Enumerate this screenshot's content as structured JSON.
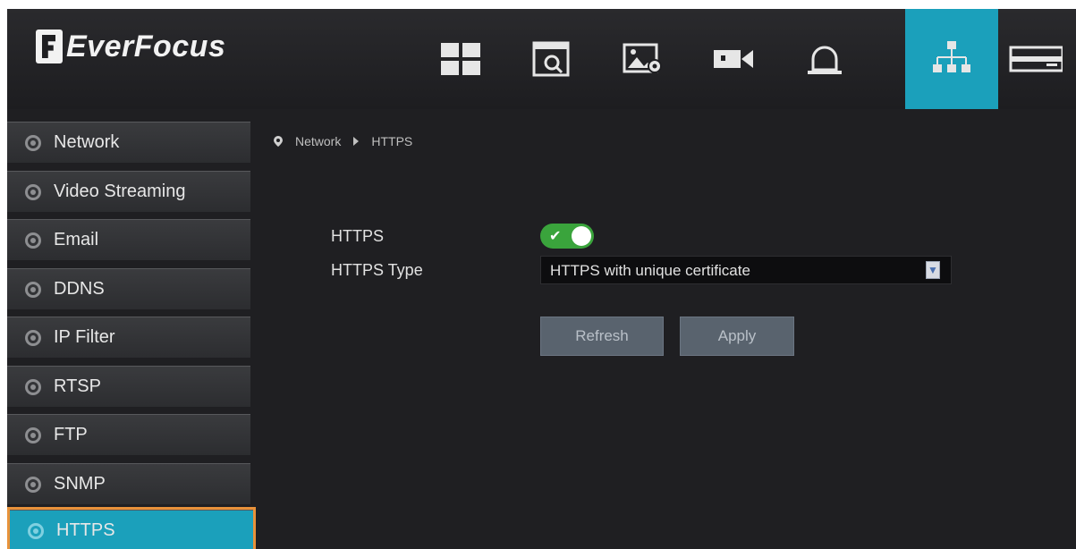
{
  "app": {
    "brand": "EverFocus"
  },
  "top_nav": {
    "icons": [
      {
        "name": "layout-grid-icon"
      },
      {
        "name": "playback-search-icon"
      },
      {
        "name": "image-settings-icon"
      },
      {
        "name": "camera-icon"
      },
      {
        "name": "alarm-bell-icon"
      },
      {
        "name": "network-icon",
        "active": true
      },
      {
        "name": "storage-icon"
      }
    ],
    "accent_color": "#1ba0bb"
  },
  "sidebar": {
    "items": [
      {
        "label": "Network"
      },
      {
        "label": "Video Streaming"
      },
      {
        "label": "Email"
      },
      {
        "label": "DDNS"
      },
      {
        "label": "IP Filter"
      },
      {
        "label": "RTSP"
      },
      {
        "label": "FTP"
      },
      {
        "label": "SNMP"
      },
      {
        "label": "HTTPS",
        "active": true
      }
    ],
    "highlight_color": "#e8923a"
  },
  "breadcrumb": {
    "parent": "Network",
    "current": "HTTPS"
  },
  "form": {
    "https_label": "HTTPS",
    "https_enabled": true,
    "https_check": "✔",
    "https_type_label": "HTTPS Type",
    "https_type_value": "HTTPS with unique certificate",
    "refresh_label": "Refresh",
    "apply_label": "Apply"
  }
}
